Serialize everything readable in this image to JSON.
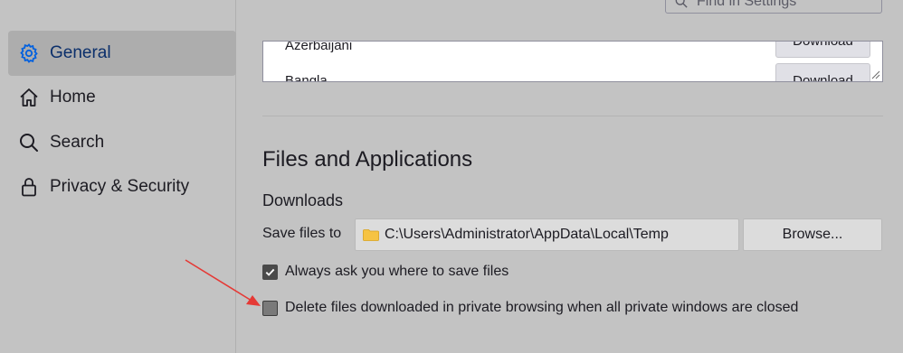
{
  "find": {
    "placeholder": "Find in Settings"
  },
  "sidebar": {
    "items": [
      {
        "label": "General",
        "icon": "gear-icon",
        "selected": true
      },
      {
        "label": "Home",
        "icon": "home-icon",
        "selected": false
      },
      {
        "label": "Search",
        "icon": "search-icon",
        "selected": false
      },
      {
        "label": "Privacy & Security",
        "icon": "lock-icon",
        "selected": false
      }
    ]
  },
  "languages": {
    "rows": [
      {
        "name": "Azerbaijani",
        "button": "Download"
      },
      {
        "name": "Bangla",
        "button": "Download"
      }
    ]
  },
  "files": {
    "section_title": "Files and Applications",
    "downloads_title": "Downloads",
    "save_label": "Save files to",
    "save_path": "C:\\Users\\Administrator\\AppData\\Local\\Temp",
    "browse_label": "Browse...",
    "always_ask_label": "Always ask you where to save files",
    "always_ask_checked": true,
    "delete_private_label": "Delete files downloaded in private browsing when all private windows are closed",
    "delete_private_checked": false
  },
  "colors": {
    "accent": "#0060df",
    "annotation_arrow": "#e53935"
  }
}
